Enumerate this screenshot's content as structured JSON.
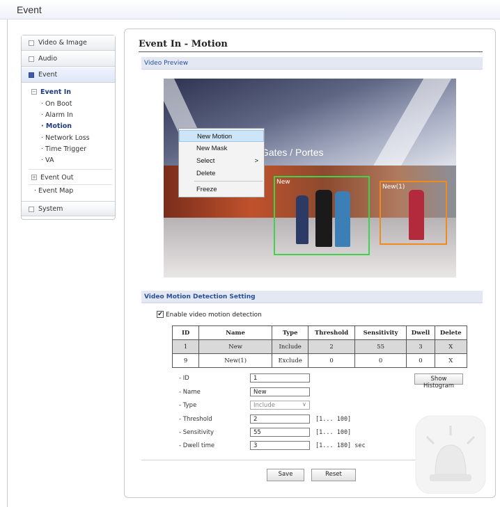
{
  "app": {
    "title": "Event"
  },
  "sidebar": {
    "items": [
      {
        "label": "Video & Image"
      },
      {
        "label": "Audio"
      },
      {
        "label": "Event"
      },
      {
        "label": "System"
      }
    ],
    "event_in": {
      "label": "Event In",
      "sub": [
        "On Boot",
        "Alarm In",
        "Motion",
        "Network Loss",
        "Time Trigger",
        "VA"
      ]
    },
    "event_out": "Event Out",
    "event_map": "Event Map"
  },
  "page": {
    "title": "Event In - Motion",
    "video_preview": "Video Preview",
    "detection_setting": "Video Motion Detection Setting"
  },
  "video": {
    "sign": "Gates / Portes",
    "regions": [
      {
        "label": "New",
        "color": "#3ed34a"
      },
      {
        "label": "New(1)",
        "color": "#f08a1c"
      }
    ]
  },
  "context_menu": {
    "items": [
      "New Motion",
      "New Mask",
      "Select",
      "Delete",
      "Freeze"
    ],
    "submenu_arrow": ">"
  },
  "enable": {
    "label": "Enable video motion detection",
    "checked": "✔"
  },
  "table": {
    "headers": [
      "ID",
      "Name",
      "Type",
      "Threshold",
      "Sensitivity",
      "Dwell",
      "Delete"
    ],
    "rows": [
      [
        "1",
        "New",
        "Include",
        "2",
        "55",
        "3",
        "X"
      ],
      [
        "9",
        "New(1)",
        "Exclude",
        "0",
        "0",
        "0",
        "X"
      ]
    ]
  },
  "form": {
    "id_label": "- ID",
    "id_value": "1",
    "name_label": "- Name",
    "name_value": "New",
    "type_label": "- Type",
    "type_value": "Include",
    "threshold_label": "- Threshold",
    "threshold_value": "2",
    "threshold_range": "[1... 100]",
    "sensitivity_label": "- Sensitivity",
    "sensitivity_value": "55",
    "sensitivity_range": "[1... 100]",
    "dwell_label": "- Dwell time",
    "dwell_value": "3",
    "dwell_range": "[1... 180] sec",
    "histogram_button": "Show Histogram",
    "chevron": "∨"
  },
  "buttons": {
    "save": "Save",
    "reset": "Reset"
  }
}
